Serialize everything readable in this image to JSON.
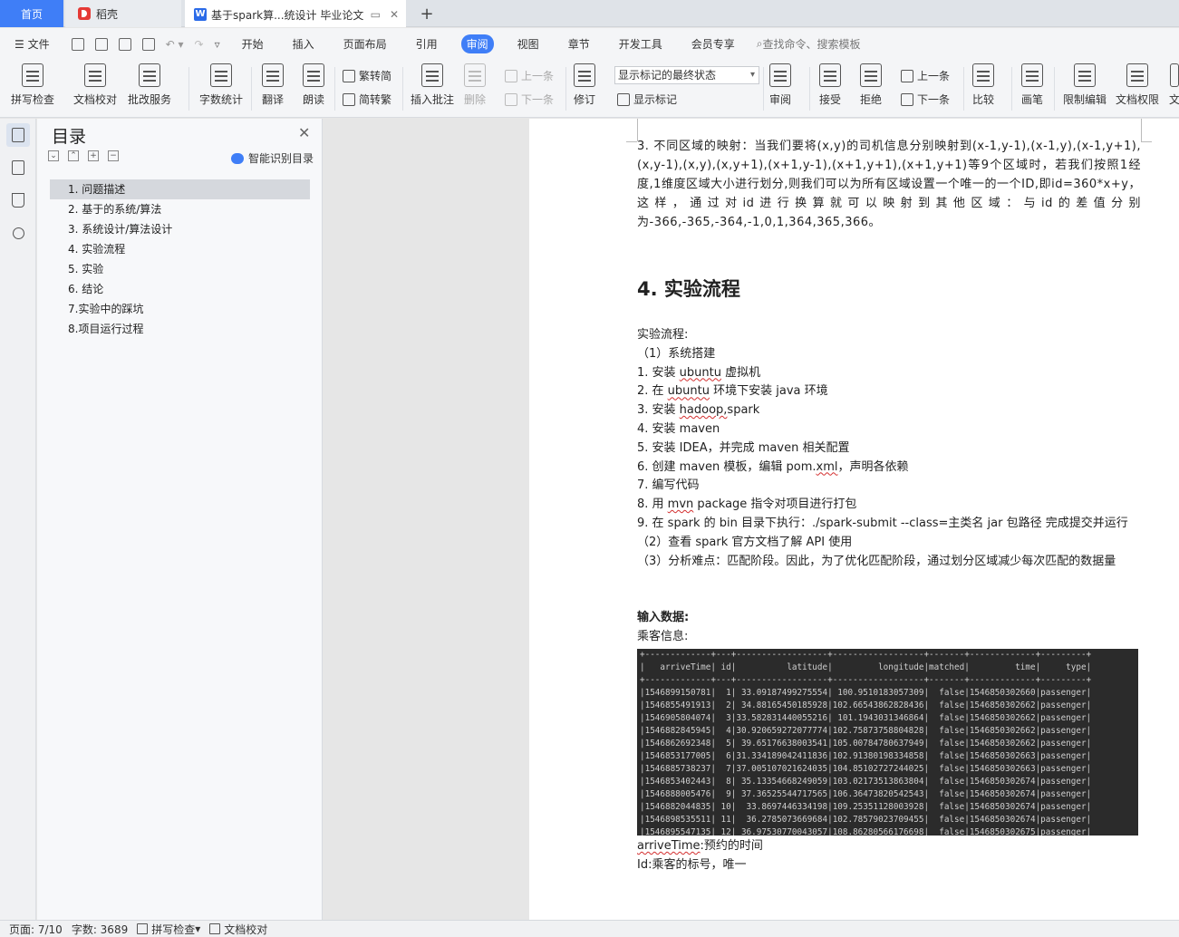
{
  "tabs": {
    "home": "首页",
    "daoke": "稻壳",
    "doc": "基于spark算...统设计 毕业论文",
    "add": "+"
  },
  "menu": {
    "file": "文件",
    "items": [
      "开始",
      "插入",
      "页面布局",
      "引用",
      "审阅",
      "视图",
      "章节",
      "开发工具",
      "会员专享"
    ],
    "search": "查找命令、搜索模板"
  },
  "toolbar": {
    "spell": "拼写检查",
    "proof": "文档校对",
    "batch": "批改服务",
    "wordcount": "字数统计",
    "translate": "翻译",
    "read": "朗读",
    "trad": "繁转简",
    "simp": "简转繁",
    "insert_comment": "插入批注",
    "delete": "删除",
    "prev1": "上一条",
    "next1": "下一条",
    "revise": "修订",
    "markup_state": "显示标记的最终状态",
    "show_markup": "显示标记",
    "review": "审阅",
    "accept": "接受",
    "reject": "拒绝",
    "prev2": "上一条",
    "next2": "下一条",
    "compare": "比较",
    "pen": "画笔",
    "restrict": "限制编辑",
    "perm": "文档权限",
    "more": "文"
  },
  "toc": {
    "title": "目录",
    "smart": "智能识别目录",
    "items": [
      "1. 问题描述",
      "2. 基于的系统/算法",
      "3. 系统设计/算法设计",
      "4. 实验流程",
      "5. 实验",
      "6. 结论",
      "7.实验中的踩坑",
      "8.项目运行过程"
    ]
  },
  "doc": {
    "para3": "3. 不同区域的映射：当我们要将(x,y)的司机信息分别映射到(x-1,y-1),(x-1,y),(x-1,y+1),(x,y-1),(x,y),(x,y+1),(x+1,y-1),(x+1,y+1),(x+1,y+1)等9个区域时，若我们按照1经度,1维度区域大小进行划分,则我们可以为所有区域设置一个唯一的一个ID,即id=360*x+y，这样，通过对id进行换算就可以映射到其他区域：与id的差值分别为-366,-365,-364,-1,0,1,364,365,366。",
    "heading": "4.  实验流程",
    "flow_label": "实验流程:",
    "step1": "（1）系统搭建",
    "s1_pre": "1.   安装 ",
    "s1_u": "ubuntu",
    "s1_post": " 虚拟机",
    "s2_pre": "2.   在 ",
    "s2_u": "ubuntu",
    "s2_post": " 环境下安装 java 环境",
    "s3_pre": "3.   安装 ",
    "s3_u": "hadoop,",
    "s3_post": "spark",
    "s4": "4.   安装 maven",
    "s5": "5.   安装 IDEA，并完成 maven 相关配置",
    "s6_pre": "6.   创建 maven 模板，编辑 pom.",
    "s6_u": "xml",
    "s6_post": "，声明各依赖",
    "s7": "7.   编写代码",
    "s8_pre": "8.   用 ",
    "s8_u": "mvn",
    "s8_post": " package 指令对项目进行打包",
    "s9": "9.   在 spark 的 bin 目录下执行：./spark-submit --class=主类名  jar 包路径    完成提交并运行",
    "step2": "（2）查看 spark 官方文档了解 API 使用",
    "step3": "（3）分析难点：匹配阶段。因此，为了优化匹配阶段，通过划分区域减少每次匹配的数据量",
    "input_label": "输入数据:",
    "passenger_label": "乘客信息:",
    "console_text": "+-------------+---+------------------+------------------+-------+-------------+---------+\n|   arriveTime| id|          latitude|         longitude|matched|         time|     type|\n+-------------+---+------------------+------------------+-------+-------------+---------+\n|1546899150781|  1| 33.09187499275554| 100.9510183057309|  false|1546850302660|passenger|\n|1546855491913|  2| 34.88165450185928|102.66543862828436|  false|1546850302662|passenger|\n|1546905804074|  3|33.582831440055216| 101.1943031346864|  false|1546850302662|passenger|\n|1546882845945|  4|30.920659272077774|102.75873758804828|  false|1546850302662|passenger|\n|1546862692348|  5| 39.65176638003541|105.00784780637949|  false|1546850302662|passenger|\n|1546853177005|  6|31.334189042411836|102.91380198334858|  false|1546850302663|passenger|\n|1546885738237|  7|37.005107021624035|104.85102727244025|  false|1546850302663|passenger|\n|1546853402443|  8| 35.13354668249059|103.02173513863804|  false|1546850302674|passenger|\n|1546888005476|  9| 37.36525544717565|106.36473820542543|  false|1546850302674|passenger|\n|1546882044835| 10|  33.8697446334198|109.25351128003928|  false|1546850302674|passenger|\n|1546898535511| 11|  36.2785073669684|102.78579023709455|  false|1546850302674|passenger|\n|1546895547135| 12| 36.97530770043057|108.86280566176698|  false|1546850302675|passenger|",
    "arrive_u": "arriveTime",
    "arrive_post": ":预约的时间",
    "id_line": "Id:乘客的标号，唯一"
  },
  "status": {
    "page": "页面: 7/10",
    "words": "字数: 3689",
    "spell": "拼写检查",
    "proof": "文档校对"
  },
  "colors": {
    "accent": "#3f7ef7",
    "console_bg": "#2b2b2b",
    "spell_underline": "#d32f2f"
  }
}
